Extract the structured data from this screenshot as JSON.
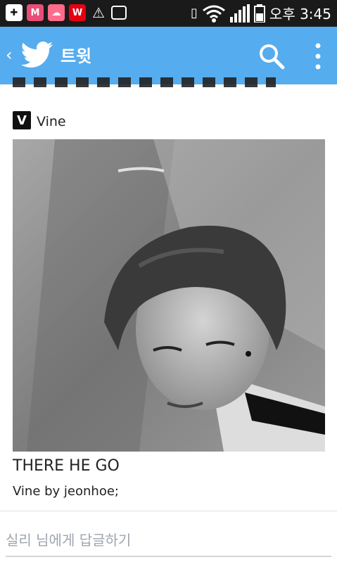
{
  "status_bar": {
    "time": "오후 3:45",
    "icons": [
      "add-icon",
      "gmail-icon",
      "cloud-icon",
      "w-app-icon",
      "warning-icon",
      "image-icon",
      "vibrate-icon",
      "wifi-icon",
      "signal-icon",
      "battery-icon"
    ],
    "w_label": "W"
  },
  "app_bar": {
    "back_label": "‹",
    "title": "트윗",
    "color": "#55acee"
  },
  "tweet": {
    "source_label": "Vine",
    "vine_badge": "V",
    "video_title": "THERE HE GO",
    "video_subtitle": "Vine by jeonhoe;"
  },
  "reply": {
    "placeholder": "실리 님에게 답글하기"
  }
}
